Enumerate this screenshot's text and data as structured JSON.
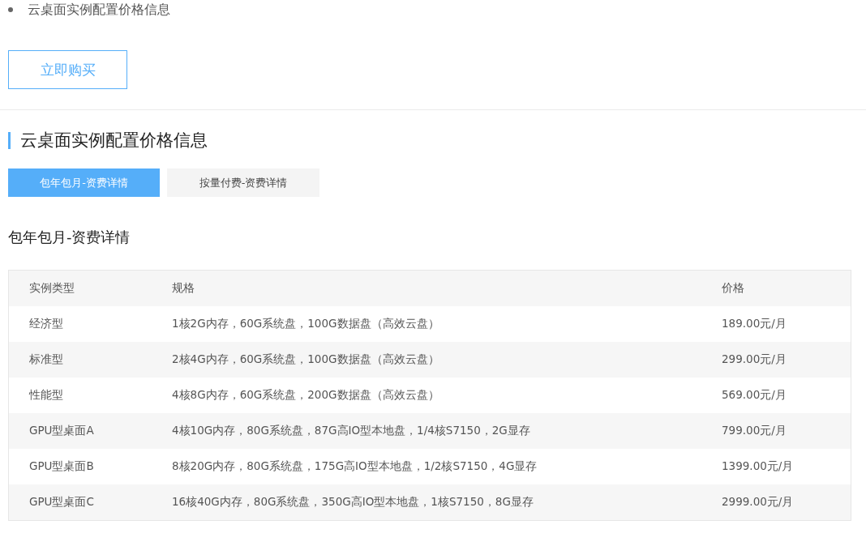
{
  "bullet_list": [
    "云桌面实例配置价格信息"
  ],
  "buy_button": "立即购买",
  "section_title": "云桌面实例配置价格信息",
  "tabs": [
    {
      "label": "包年包月-资费详情",
      "selected": true
    },
    {
      "label": "按量付费-资费详情",
      "selected": false
    }
  ],
  "subheading": "包年包月-资费详情",
  "table": {
    "columns": [
      "实例类型",
      "规格",
      "价格"
    ],
    "rows": [
      [
        "经济型",
        "1核2G内存，60G系统盘，100G数据盘（高效云盘）",
        "189.00元/月"
      ],
      [
        "标准型",
        "2核4G内存，60G系统盘，100G数据盘（高效云盘）",
        "299.00元/月"
      ],
      [
        "性能型",
        "4核8G内存，60G系统盘，200G数据盘（高效云盘）",
        "569.00元/月"
      ],
      [
        "GPU型桌面A",
        "4核10G内存，80G系统盘，87G高IO型本地盘，1/4核S7150，2G显存",
        "799.00元/月"
      ],
      [
        "GPU型桌面B",
        "8核20G内存，80G系统盘，175G高IO型本地盘，1/2核S7150，4G显存",
        "1399.00元/月"
      ],
      [
        "GPU型桌面C",
        "16核40G内存，80G系统盘，350G高IO型本地盘，1核S7150，8G显存",
        "2999.00元/月"
      ]
    ]
  }
}
